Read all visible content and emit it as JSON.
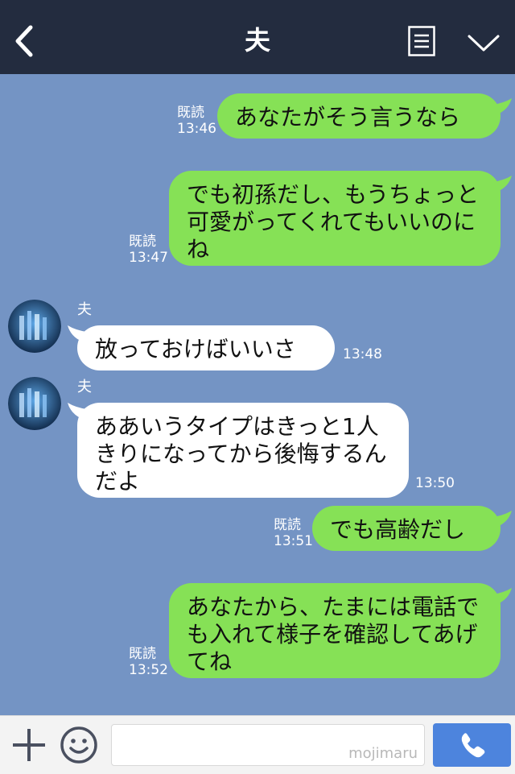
{
  "header": {
    "title": "夫"
  },
  "messages": [
    {
      "side": "me",
      "text": "あなたがそう言うなら",
      "read": "既読",
      "time": "13:46"
    },
    {
      "side": "me",
      "text": "でも初孫だし、もうちょっと可愛がってくれてもいいのにね",
      "read": "既読",
      "time": "13:47"
    },
    {
      "side": "them",
      "sender": "夫",
      "text": "放っておけばいいさ",
      "time": "13:48"
    },
    {
      "side": "them",
      "sender": "夫",
      "text": "ああいうタイプはきっと1人きりになってから後悔するんだよ",
      "time": "13:50"
    },
    {
      "side": "me",
      "text": "でも高齢だし",
      "read": "既読",
      "time": "13:51"
    },
    {
      "side": "me",
      "text": "あなたから、たまには電話でも入れて様子を確認してあげてね",
      "read": "既読",
      "time": "13:52"
    }
  ],
  "footer": {
    "watermark": "mojimaru"
  },
  "colors": {
    "header_bg": "#232c3f",
    "chat_bg": "#7494c4",
    "my_bubble": "#86e156",
    "their_bubble": "#ffffff",
    "call_button": "#4d84dd"
  }
}
